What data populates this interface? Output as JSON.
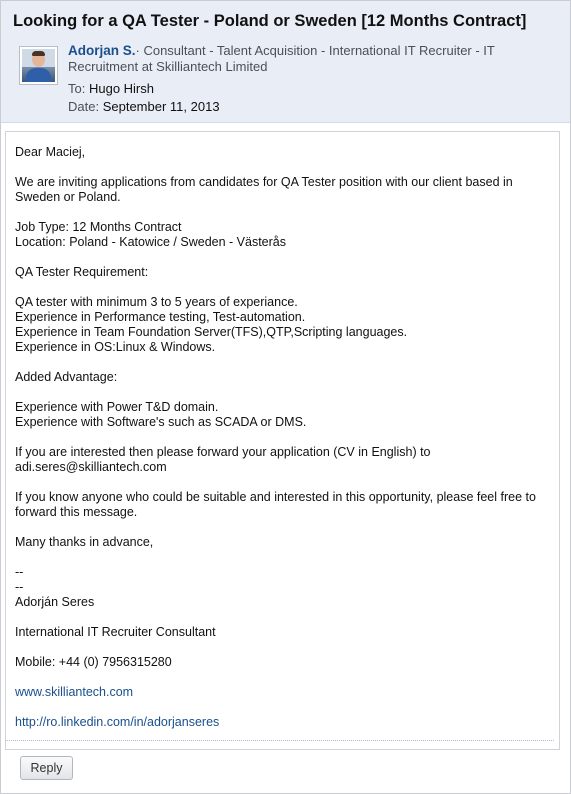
{
  "email": {
    "subject": "Looking for a QA Tester - Poland or Sweden [12 Months Contract]",
    "sender_name": "Adorjan S.",
    "sender_title": "· Consultant - Talent Acquisition - International IT Recruiter - IT Recruitment at Skilliantech Limited",
    "to_label": "To:",
    "to_value": "Hugo Hirsh",
    "date_label": "Date:",
    "date_value": "September 11, 2013"
  },
  "body": {
    "greeting": "Dear Maciej,",
    "intro": "We are inviting applications from candidates for QA Tester position with our client based in Sweden or Poland.",
    "job_type": "Job Type: 12 Months Contract",
    "location": "Location: Poland - Katowice / Sweden - Västerås",
    "req_heading": "QA Tester Requirement:",
    "req_1": "QA tester with minimum 3 to 5 years of experiance.",
    "req_2": "Experience in Performance testing, Test-automation.",
    "req_3": "Experience in Team Foundation Server(TFS),QTP,Scripting languages.",
    "req_4": "Experience in OS:Linux & Windows.",
    "adv_heading": "Added Advantage:",
    "adv_1": "Experience with Power T&D domain.",
    "adv_2": "Experience with Software's such as SCADA or DMS.",
    "apply": "If you are interested then please forward your application (CV in English) to adi.seres@skilliantech.com",
    "forward": "If you know anyone who could be suitable and interested in this opportunity, please feel free to forward this message.",
    "thanks": "Many thanks in advance,",
    "sig_dash_1": "--",
    "sig_dash_2": "--",
    "sig_name": "Adorján Seres",
    "sig_title": "International IT Recruiter Consultant",
    "sig_mobile": "Mobile: +44 (0) 7956315280",
    "sig_web": "www.skilliantech.com",
    "sig_linkedin": "http://ro.linkedin.com/in/adorjanseres"
  },
  "actions": {
    "reply_label": "Reply"
  },
  "colors": {
    "header_bg": "#e9edf6",
    "link": "#1a4f8c"
  }
}
